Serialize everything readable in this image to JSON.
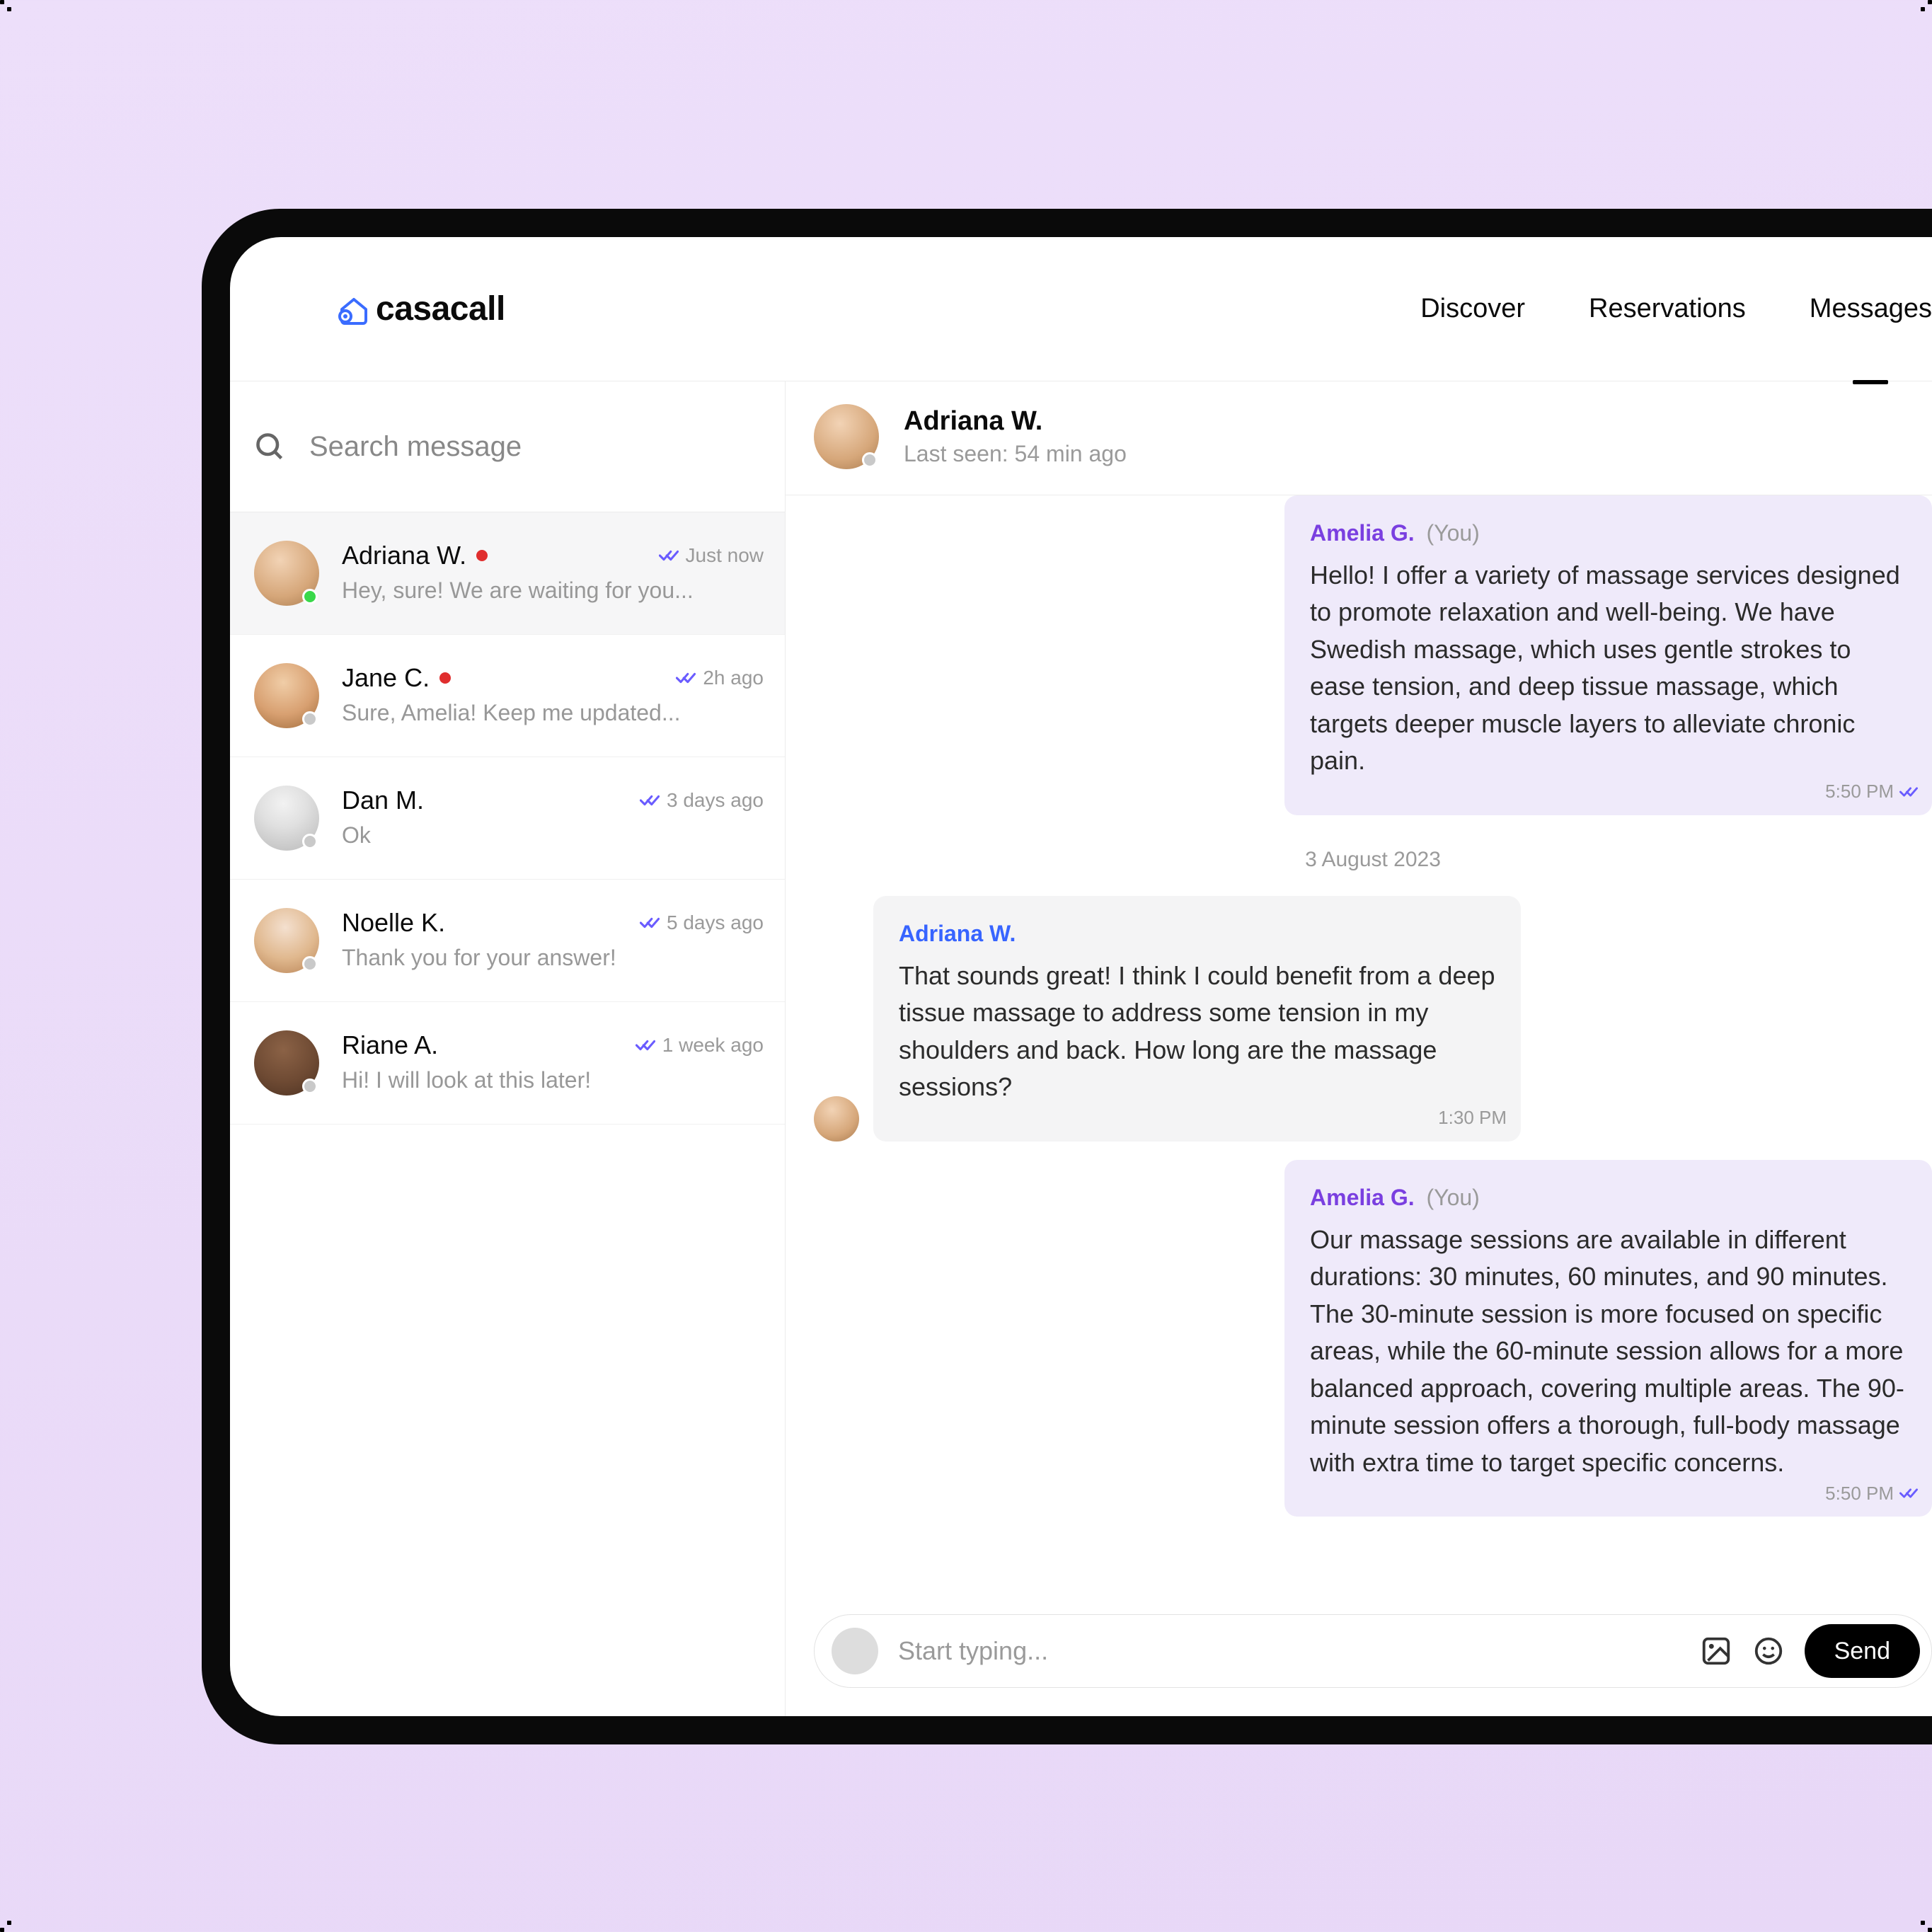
{
  "brand": "casacall",
  "nav": {
    "discover": "Discover",
    "reservations": "Reservations",
    "messages": "Messages"
  },
  "search": {
    "placeholder": "Search message"
  },
  "conversations": [
    {
      "name": "Adriana W.",
      "preview": "Hey, sure! We are waiting for you...",
      "time": "Just now",
      "unread": true,
      "online": true
    },
    {
      "name": "Jane C.",
      "preview": "Sure, Amelia! Keep me updated...",
      "time": "2h ago",
      "unread": true,
      "online": false
    },
    {
      "name": "Dan M.",
      "preview": "Ok",
      "time": "3 days ago",
      "unread": false,
      "online": false
    },
    {
      "name": "Noelle K.",
      "preview": "Thank you for your answer!",
      "time": "5 days ago",
      "unread": false,
      "online": false
    },
    {
      "name": "Riane A.",
      "preview": "Hi! I will look at this later!",
      "time": "1 week ago",
      "unread": false,
      "online": false
    }
  ],
  "chat": {
    "title": "Adriana W.",
    "subtitle": "Last seen: 54 min ago",
    "date_divider": "3 August 2023",
    "messages": [
      {
        "side": "right",
        "sender": "Amelia G.",
        "you": "(You)",
        "body": "Hello! I offer a variety of massage services designed to promote relaxation and well-being. We have Swedish massage, which uses gentle strokes to ease tension, and deep tissue massage, which targets deeper muscle layers to alleviate chronic pain.",
        "time": "5:50 PM"
      },
      {
        "side": "left",
        "sender": "Adriana W.",
        "body": "That sounds great! I think I could benefit from a deep tissue massage to address some tension in my shoulders and back. How long are the massage sessions?",
        "time": "1:30 PM"
      },
      {
        "side": "right",
        "sender": "Amelia G.",
        "you": "(You)",
        "body": "Our massage sessions are available in different durations: 30 minutes, 60 minutes, and 90 minutes. The 30-minute session is more focused on specific areas, while the 60-minute session allows for a more balanced approach, covering multiple areas. The 90-minute session offers a thorough, full-body massage with extra time to target specific concerns.",
        "time": "5:50 PM"
      }
    ]
  },
  "composer": {
    "placeholder": "Start typing...",
    "send": "Send"
  }
}
